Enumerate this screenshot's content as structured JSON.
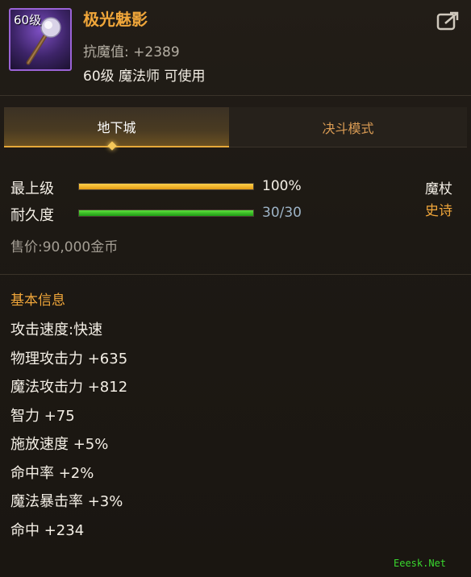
{
  "item": {
    "level_tag": "60级",
    "name": "极光魅影",
    "resist_label": "抗魔值:",
    "resist_value": "+2389",
    "requirement": "60级 魔法师 可使用",
    "weapon_type": "魔杖",
    "rarity": "史诗"
  },
  "tabs": [
    {
      "label": "地下城",
      "active": true
    },
    {
      "label": "决斗模式",
      "active": false
    }
  ],
  "stats": {
    "upgrade_label": "最上级",
    "upgrade_value": "100%",
    "upgrade_fraction": 1.0,
    "durability_label": "耐久度",
    "durability_value": "30/30",
    "durability_fraction": 1.0
  },
  "price": "售价:90,000金币",
  "basic_info": {
    "title": "基本信息",
    "attributes": [
      "攻击速度:快速",
      "物理攻击力 +635",
      "魔法攻击力 +812",
      "智力 +75",
      "施放速度 +5%",
      "命中率 +2%",
      "魔法暴击率 +3%",
      "命中 +234"
    ]
  },
  "icons": {
    "item": "magic-staff-icon",
    "share": "share-icon"
  },
  "colors": {
    "name": "#f0a63a",
    "rarity": "#f0a63a",
    "upgrade_bar": "#e8a51c",
    "durability_bar": "#34c024",
    "icon_border": "#9a63d6"
  },
  "watermark": "Eeesk.Net"
}
